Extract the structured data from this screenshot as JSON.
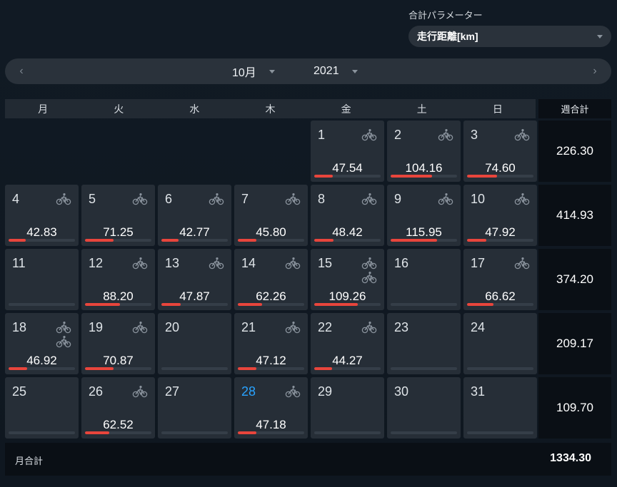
{
  "param": {
    "label": "合計パラメーター",
    "value": "走行距離[km]"
  },
  "nav": {
    "prev": "‹",
    "next": "›",
    "month": "10月",
    "year": "2021"
  },
  "weekdays": [
    "月",
    "火",
    "水",
    "木",
    "金",
    "土",
    "日"
  ],
  "week_total_header": "週合計",
  "days": [
    {
      "day": "",
      "empty": true
    },
    {
      "day": "",
      "empty": true
    },
    {
      "day": "",
      "empty": true
    },
    {
      "day": "",
      "empty": true
    },
    {
      "day": "1",
      "value": "47.54",
      "rides": 1,
      "fill": 0.28
    },
    {
      "day": "2",
      "value": "104.16",
      "rides": 1,
      "fill": 0.62
    },
    {
      "day": "3",
      "value": "74.60",
      "rides": 1,
      "fill": 0.45
    },
    {
      "day": "4",
      "value": "42.83",
      "rides": 1,
      "fill": 0.26
    },
    {
      "day": "5",
      "value": "71.25",
      "rides": 1,
      "fill": 0.43
    },
    {
      "day": "6",
      "value": "42.77",
      "rides": 1,
      "fill": 0.26
    },
    {
      "day": "7",
      "value": "45.80",
      "rides": 1,
      "fill": 0.28
    },
    {
      "day": "8",
      "value": "48.42",
      "rides": 1,
      "fill": 0.29
    },
    {
      "day": "9",
      "value": "115.95",
      "rides": 1,
      "fill": 0.7
    },
    {
      "day": "10",
      "value": "47.92",
      "rides": 1,
      "fill": 0.29
    },
    {
      "day": "11",
      "value": "",
      "rides": 0,
      "fill": 0
    },
    {
      "day": "12",
      "value": "88.20",
      "rides": 1,
      "fill": 0.53
    },
    {
      "day": "13",
      "value": "47.87",
      "rides": 1,
      "fill": 0.29
    },
    {
      "day": "14",
      "value": "62.26",
      "rides": 1,
      "fill": 0.37
    },
    {
      "day": "15",
      "value": "109.26",
      "rides": 2,
      "fill": 0.66
    },
    {
      "day": "16",
      "value": "",
      "rides": 0,
      "fill": 0
    },
    {
      "day": "17",
      "value": "66.62",
      "rides": 1,
      "fill": 0.4
    },
    {
      "day": "18",
      "value": "46.92",
      "rides": 2,
      "fill": 0.28
    },
    {
      "day": "19",
      "value": "70.87",
      "rides": 1,
      "fill": 0.43
    },
    {
      "day": "20",
      "value": "",
      "rides": 0,
      "fill": 0
    },
    {
      "day": "21",
      "value": "47.12",
      "rides": 1,
      "fill": 0.28
    },
    {
      "day": "22",
      "value": "44.27",
      "rides": 1,
      "fill": 0.27
    },
    {
      "day": "23",
      "value": "",
      "rides": 0,
      "fill": 0
    },
    {
      "day": "24",
      "value": "",
      "rides": 0,
      "fill": 0
    },
    {
      "day": "25",
      "value": "",
      "rides": 0,
      "fill": 0
    },
    {
      "day": "26",
      "value": "62.52",
      "rides": 1,
      "fill": 0.37
    },
    {
      "day": "27",
      "value": "",
      "rides": 0,
      "fill": 0
    },
    {
      "day": "28",
      "value": "47.18",
      "rides": 1,
      "fill": 0.28,
      "today": true
    },
    {
      "day": "29",
      "value": "",
      "rides": 0,
      "fill": 0
    },
    {
      "day": "30",
      "value": "",
      "rides": 0,
      "fill": 0
    },
    {
      "day": "31",
      "value": "",
      "rides": 0,
      "fill": 0
    }
  ],
  "week_totals": [
    "226.30",
    "414.93",
    "374.20",
    "209.17",
    "109.70"
  ],
  "month_total": {
    "label": "月合計",
    "value": "1334.30"
  },
  "colors": {
    "accent": "#e8453c",
    "today": "#29a3ff",
    "cell": "#262e37"
  },
  "icons": {
    "ride": "bicycle-rider-icon"
  }
}
